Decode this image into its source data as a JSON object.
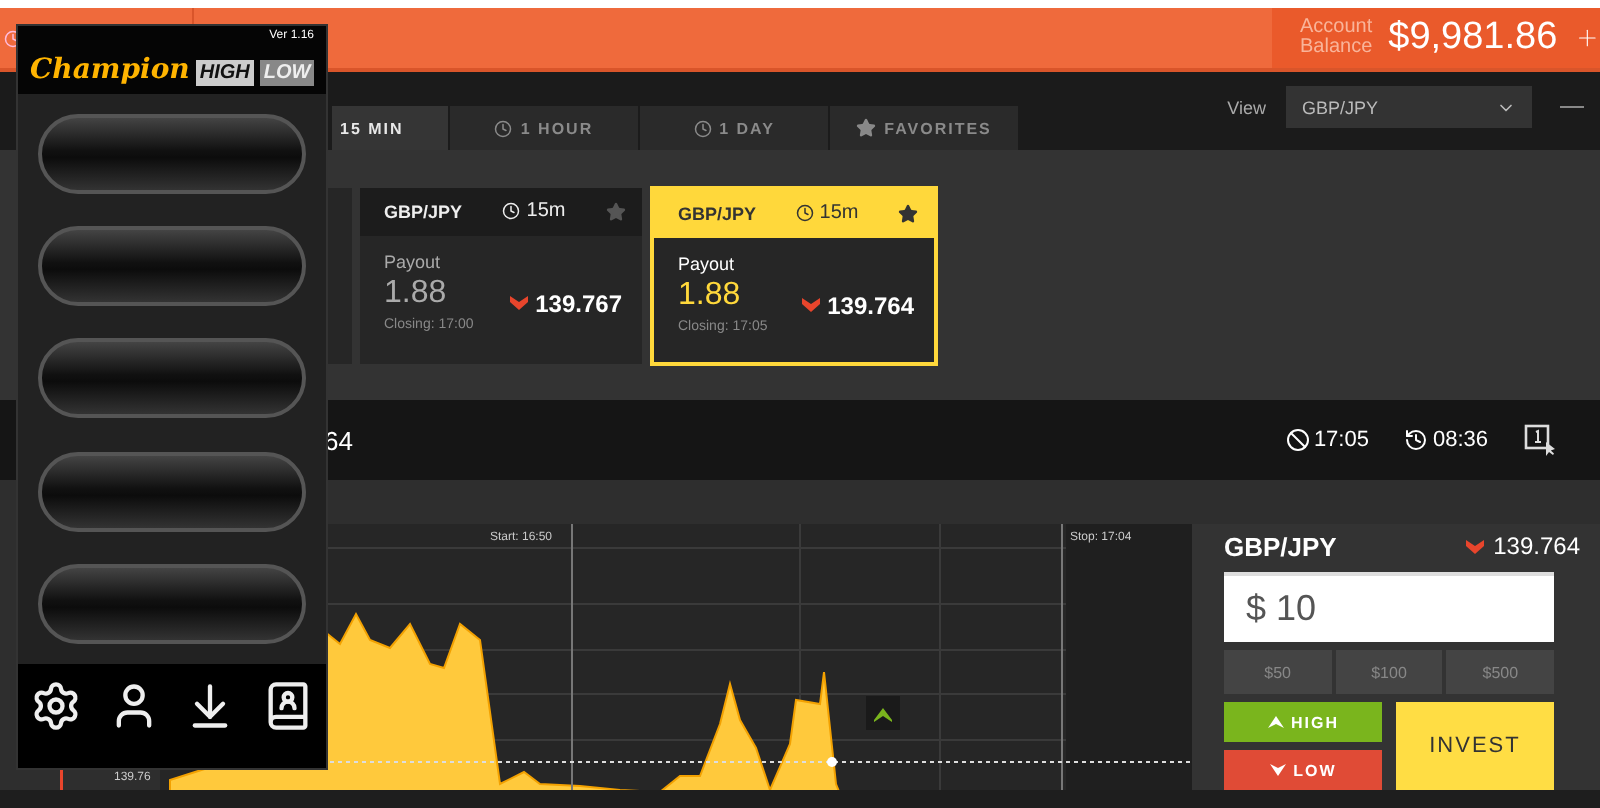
{
  "header": {
    "balance_label": "Account Balance",
    "balance": "$9,981.86"
  },
  "tabs": [
    {
      "label": "15 MIN",
      "kind": "none",
      "selected": true
    },
    {
      "label": "1 HOUR",
      "kind": "clock",
      "selected": false
    },
    {
      "label": "1 DAY",
      "kind": "clock",
      "selected": false
    },
    {
      "label": "FAVORITES",
      "kind": "star",
      "selected": false
    }
  ],
  "view": {
    "label": "View",
    "value": "GBP/JPY"
  },
  "cards": [
    {
      "pair": "GBP/JPY",
      "duration": "15m",
      "payout_label": "Payout",
      "payout": "1.88",
      "rate": "139.767",
      "closing": "Closing: 17:00",
      "selected": false
    },
    {
      "pair": "GBP/JPY",
      "duration": "15m",
      "payout_label": "Payout",
      "payout": "1.88",
      "rate": "139.764",
      "closing": "Closing: 17:05",
      "selected": true
    }
  ],
  "asset_bar": {
    "rate": "64",
    "expiry": "17:05",
    "remaining": "08:36"
  },
  "chart": {
    "start": "Start: 16:50",
    "stop": "Stop: 17:04",
    "price": "139.76"
  },
  "trade": {
    "pair": "GBP/JPY",
    "rate": "139.764",
    "amount": "$ 10",
    "presets": [
      "$50",
      "$100",
      "$500"
    ],
    "high": "HIGH",
    "low": "LOW",
    "invest": "INVEST"
  },
  "widget": {
    "version": "Ver 1.16",
    "brand": "Champion",
    "high": "HIGH",
    "low": "LOW"
  }
}
